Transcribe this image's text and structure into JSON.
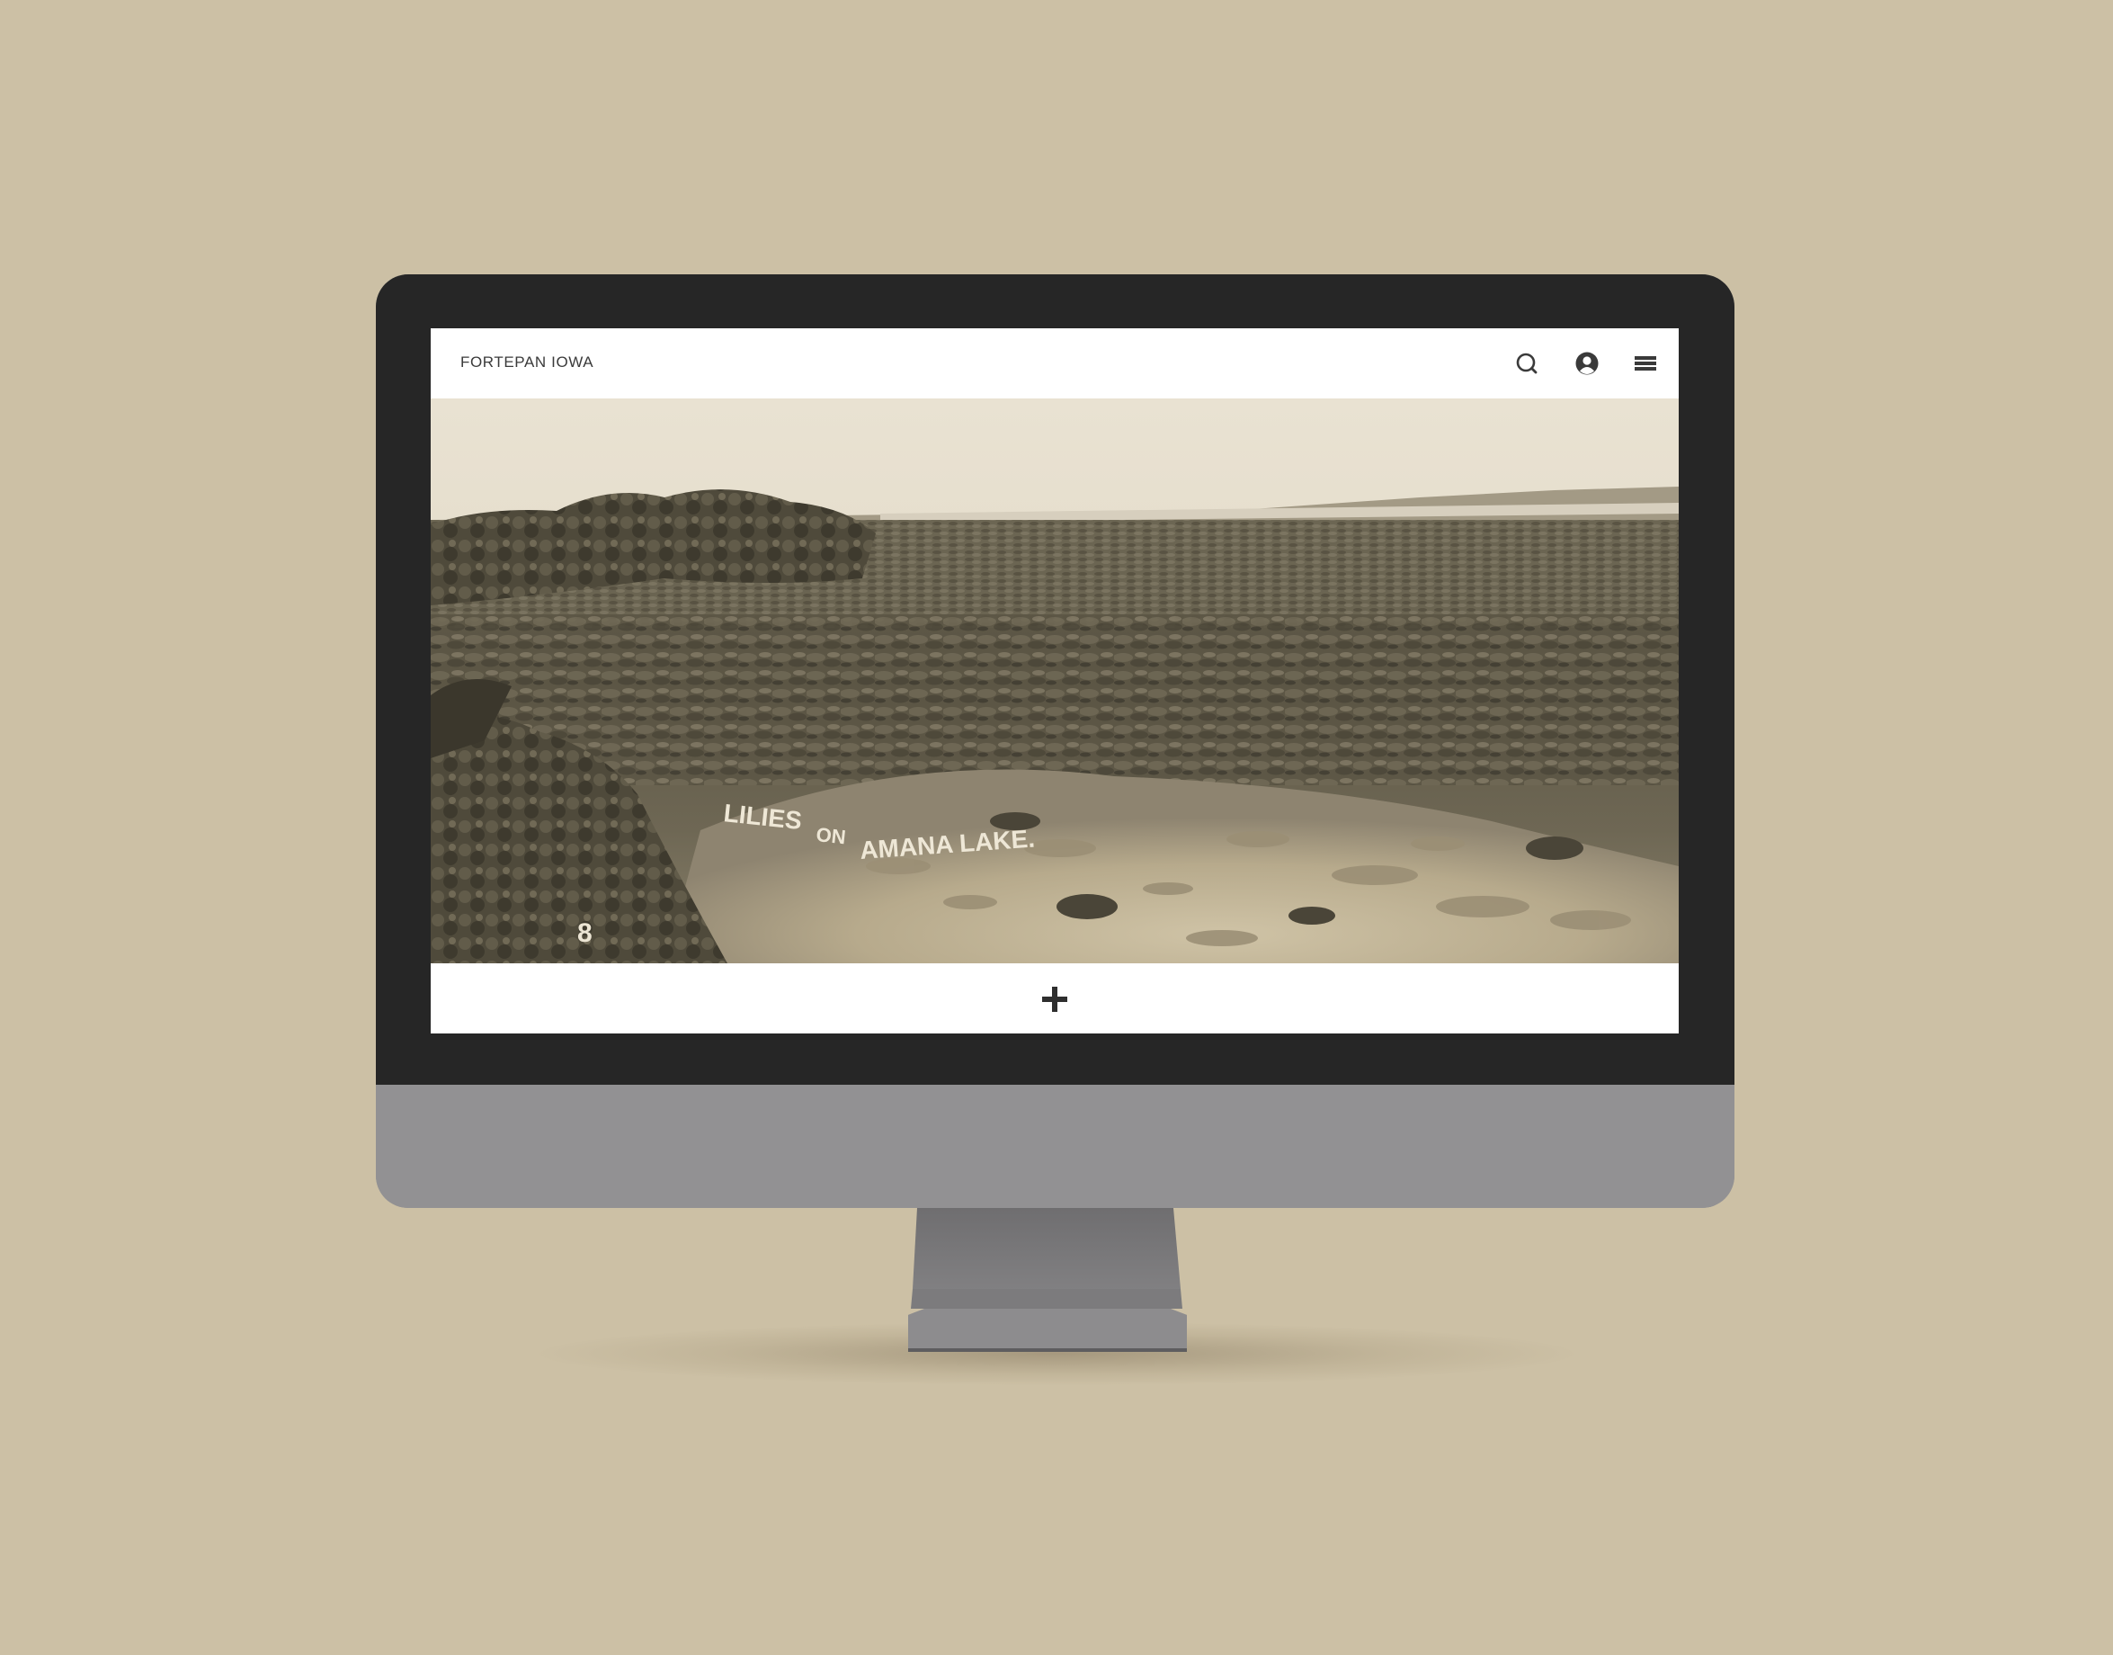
{
  "site": {
    "brand": "FORTEPAN IOWA"
  },
  "header": {
    "icons": [
      "search-icon",
      "account-icon",
      "menu-icon"
    ]
  },
  "photo": {
    "caption_lines": [
      "LILIES",
      "ON",
      "AMANA LAKE."
    ],
    "plate_number": "8",
    "tone": "sepia"
  },
  "footer": {
    "expand_icon": "plus-icon"
  },
  "colors": {
    "background": "#ccc0a5",
    "bezel": "#262626",
    "chin": "#929193",
    "screen": "#ffffff",
    "icon": "#3a3a3a"
  }
}
